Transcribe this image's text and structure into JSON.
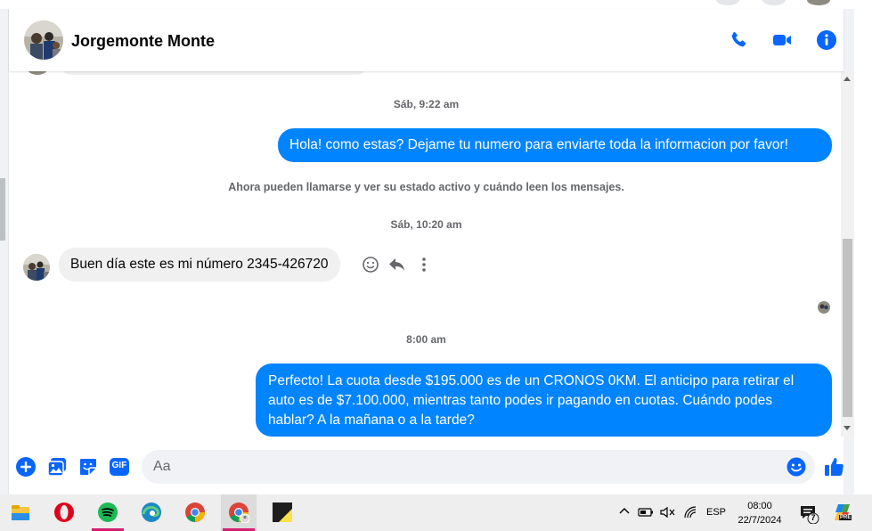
{
  "header": {
    "contact_name": "Jorgemonte Monte",
    "icons": [
      "phone-icon",
      "video-call-icon",
      "info-icon"
    ]
  },
  "messages": [
    {
      "type": "timestamp",
      "text": "Sáb, 9:22 am"
    },
    {
      "type": "outgoing",
      "text": "Hola! como estas? Dejame tu numero para enviarte toda la informacion por favor!"
    },
    {
      "type": "info",
      "text": "Ahora pueden llamarse y ver su estado activo y cuándo leen los mensajes."
    },
    {
      "type": "timestamp",
      "text": "Sáb, 10:20 am"
    },
    {
      "type": "incoming",
      "text": "Buen día este es mi número 2345-426720"
    },
    {
      "type": "timestamp",
      "text": "8:00 am"
    },
    {
      "type": "outgoing",
      "lines": [
        "Perfecto! La cuota desde $195.000 es de un CRONOS 0KM. El anticipo para retirar el",
        "auto es de $7.100.000, mientras tanto podes ir pagando en cuotas. Cuándo podes",
        "hablar? A la mañana o a la tarde?"
      ]
    }
  ],
  "message_actions": [
    "react-icon",
    "reply-icon",
    "more-icon"
  ],
  "composer": {
    "placeholder": "Aa",
    "icons": [
      "add-icon",
      "image-icon",
      "sticker-icon",
      "gif-icon",
      "emoji-icon",
      "like-icon"
    ],
    "gif_label": "GIF"
  },
  "taskbar": {
    "apps": [
      "file-explorer-icon",
      "opera-icon",
      "spotify-icon",
      "edge-icon",
      "chrome-icon",
      "chrome-profile-icon",
      "sticky-notes-icon"
    ],
    "language": "ESP",
    "time": "08:00",
    "date": "22/7/2024",
    "notification_count": "7",
    "copilot_badge": "PRE"
  },
  "colors": {
    "accent": "#0084ff",
    "incoming_bubble": "#f0f0f0",
    "taskbar": "#eeeeee",
    "active_underline": "#d61f6f"
  }
}
